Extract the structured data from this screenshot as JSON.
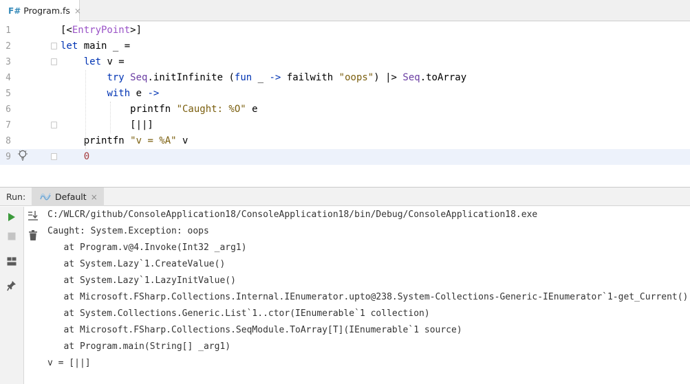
{
  "editor_tab": {
    "lang_badge": "F#",
    "file_name": "Program.fs",
    "close_glyph": "×"
  },
  "code_lines": [
    {
      "number": "1",
      "tokens": [
        {
          "t": "[<",
          "c": "fn"
        },
        {
          "t": "EntryPoint",
          "c": "attr"
        },
        {
          "t": ">]",
          "c": "fn"
        }
      ]
    },
    {
      "number": "2",
      "tokens": [
        {
          "t": "let",
          "c": "kw"
        },
        {
          "t": " main _ =",
          "c": "fn"
        }
      ]
    },
    {
      "number": "3",
      "tokens": [
        {
          "t": "    ",
          "c": "fn"
        },
        {
          "t": "let",
          "c": "kw"
        },
        {
          "t": " v =",
          "c": "fn"
        }
      ]
    },
    {
      "number": "4",
      "tokens": [
        {
          "t": "        ",
          "c": "fn"
        },
        {
          "t": "try",
          "c": "kw"
        },
        {
          "t": " ",
          "c": "fn"
        },
        {
          "t": "Seq",
          "c": "ty"
        },
        {
          "t": ".initInfinite (",
          "c": "fn"
        },
        {
          "t": "fun",
          "c": "kw"
        },
        {
          "t": " _ ",
          "c": "fn"
        },
        {
          "t": "->",
          "c": "kw"
        },
        {
          "t": " failwith ",
          "c": "fn"
        },
        {
          "t": "\"oops\"",
          "c": "str"
        },
        {
          "t": ") |> ",
          "c": "fn"
        },
        {
          "t": "Seq",
          "c": "ty"
        },
        {
          "t": ".toArray",
          "c": "fn"
        }
      ]
    },
    {
      "number": "5",
      "tokens": [
        {
          "t": "        ",
          "c": "fn"
        },
        {
          "t": "with",
          "c": "kw"
        },
        {
          "t": " e ",
          "c": "fn"
        },
        {
          "t": "->",
          "c": "kw"
        }
      ]
    },
    {
      "number": "6",
      "tokens": [
        {
          "t": "            printfn ",
          "c": "fn"
        },
        {
          "t": "\"Caught: %O\"",
          "c": "str"
        },
        {
          "t": " e",
          "c": "fn"
        }
      ]
    },
    {
      "number": "7",
      "tokens": [
        {
          "t": "            [||]",
          "c": "fn"
        }
      ]
    },
    {
      "number": "8",
      "tokens": [
        {
          "t": "    printfn ",
          "c": "fn"
        },
        {
          "t": "\"v = %A\"",
          "c": "str"
        },
        {
          "t": " v",
          "c": "fn"
        }
      ]
    },
    {
      "number": "9",
      "tokens": [
        {
          "t": "    ",
          "c": "fn"
        },
        {
          "t": "0",
          "c": "num"
        }
      ]
    }
  ],
  "run_panel": {
    "label": "Run:",
    "tab_name": "Default",
    "close_glyph": "×",
    "output": [
      "C:/WLCR/github/ConsoleApplication18/ConsoleApplication18/bin/Debug/ConsoleApplication18.exe",
      "Caught: System.Exception: oops",
      "   at Program.v@4.Invoke(Int32 _arg1)",
      "   at System.Lazy`1.CreateValue()",
      "   at System.Lazy`1.LazyInitValue()",
      "   at Microsoft.FSharp.Collections.Internal.IEnumerator.upto@238.System-Collections-Generic-IEnumerator`1-get_Current()",
      "   at System.Collections.Generic.List`1..ctor(IEnumerable`1 collection)",
      "   at Microsoft.FSharp.Collections.SeqModule.ToArray[T](IEnumerable`1 source)",
      "   at Program.main(String[] _arg1)",
      "v = [||]"
    ]
  },
  "colors": {
    "keyword": "#0033b3",
    "attribute": "#9a53c7",
    "string": "#7a5e0d",
    "number": "#a53c3c",
    "type": "#6b3ea3",
    "run_green": "#3c9a3c"
  },
  "icons": {
    "file_tab": "fsharp-file-icon",
    "gutter_line9": "lightbulb-icon",
    "run_tab": "run-config-icon",
    "toolbar": [
      "run-icon",
      "stop-icon",
      "layout-icon",
      "pin-icon",
      "scroll-to-end-icon",
      "trash-icon"
    ]
  }
}
